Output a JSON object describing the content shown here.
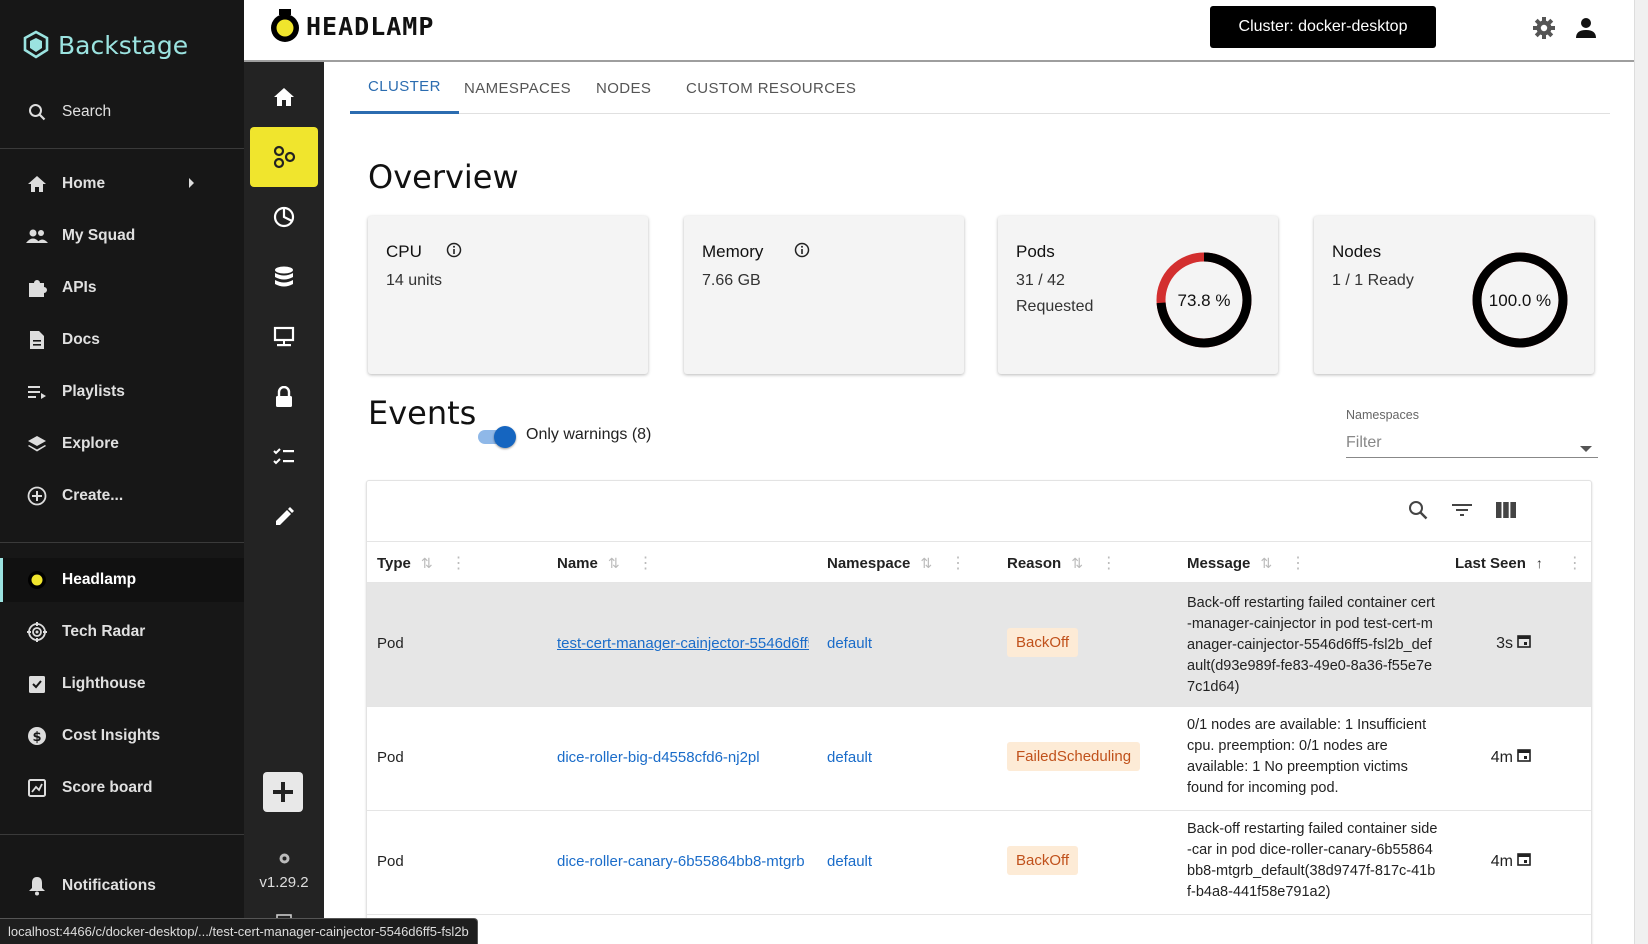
{
  "backstage": {
    "logo": "Backstage",
    "search": "Search",
    "items": [
      {
        "label": "Home",
        "icon": "home-icon"
      },
      {
        "label": "My Squad",
        "icon": "people-icon"
      },
      {
        "label": "APIs",
        "icon": "puzzle-icon"
      },
      {
        "label": "Docs",
        "icon": "document-icon"
      },
      {
        "label": "Playlists",
        "icon": "playlist-icon"
      },
      {
        "label": "Explore",
        "icon": "layers-icon"
      },
      {
        "label": "Create...",
        "icon": "plus-circle-icon"
      }
    ],
    "plugins": [
      {
        "label": "Headlamp",
        "icon": "headlamp-icon"
      },
      {
        "label": "Tech Radar",
        "icon": "radar-icon"
      },
      {
        "label": "Lighthouse",
        "icon": "clipboard-check-icon"
      },
      {
        "label": "Cost Insights",
        "icon": "dollar-icon"
      },
      {
        "label": "Score board",
        "icon": "scoreboard-icon"
      }
    ],
    "notifications": "Notifications"
  },
  "headlamp": {
    "brand": "HEADLAMP",
    "cluster_button": "Cluster: docker-desktop",
    "version": "v1.29.2"
  },
  "tabs": [
    "CLUSTER",
    "NAMESPACES",
    "NODES",
    "CUSTOM RESOURCES"
  ],
  "overview": {
    "title": "Overview",
    "cards": {
      "cpu": {
        "title": "CPU",
        "value": "14 units"
      },
      "memory": {
        "title": "Memory",
        "value": "7.66 GB"
      },
      "pods": {
        "title": "Pods",
        "value": "31 / 42 Requested",
        "percent_label": "73.8 %",
        "percent": 73.8
      },
      "nodes": {
        "title": "Nodes",
        "value": "1 / 1 Ready",
        "percent_label": "100.0 %",
        "percent": 100
      }
    }
  },
  "events": {
    "title": "Events",
    "only_warnings": "Only warnings (8)",
    "namespaces_label": "Namespaces",
    "namespaces_placeholder": "Filter",
    "columns": [
      "Type",
      "Name",
      "Namespace",
      "Reason",
      "Message",
      "Last Seen"
    ],
    "rows": [
      {
        "type": "Pod",
        "name": "test-cert-manager-cainjector-5546d6ff5-fsl2b",
        "namespace": "default",
        "reason": "BackOff",
        "message": "Back-off restarting failed container cert-manager-cainjector in pod test-cert-manager-cainjector-5546d6ff5-fsl2b_default(d93e989f-fe83-49e0-8a36-f55e7e7c1d64)",
        "last_seen": "3s"
      },
      {
        "type": "Pod",
        "name": "dice-roller-big-d4558cfd6-nj2pl",
        "namespace": "default",
        "reason": "FailedScheduling",
        "message": "0/1 nodes are available: 1 Insufficient cpu. preemption: 0/1 nodes are available: 1 No preemption victims found for incoming pod.",
        "last_seen": "4m"
      },
      {
        "type": "Pod",
        "name": "dice-roller-canary-6b55864bb8-mtgrb",
        "namespace": "default",
        "reason": "BackOff",
        "message": "Back-off restarting failed container side-car in pod dice-roller-canary-6b55864bb8-mtgrb_default(38d9747f-817c-41bf-b4a8-441f58e791a2)",
        "last_seen": "4m"
      }
    ]
  },
  "statusbar": "localhost:4466/c/docker-desktop/.../test-cert-manager-cainjector-5546d6ff5-fsl2b",
  "colors": {
    "accent": "#2b6cb0",
    "rail_active": "#f0e52d",
    "badge_bg": "#fdebd6",
    "badge_text": "#c0511b",
    "donut_warn": "#d32f2f",
    "backstage_teal": "#9be3e0"
  }
}
